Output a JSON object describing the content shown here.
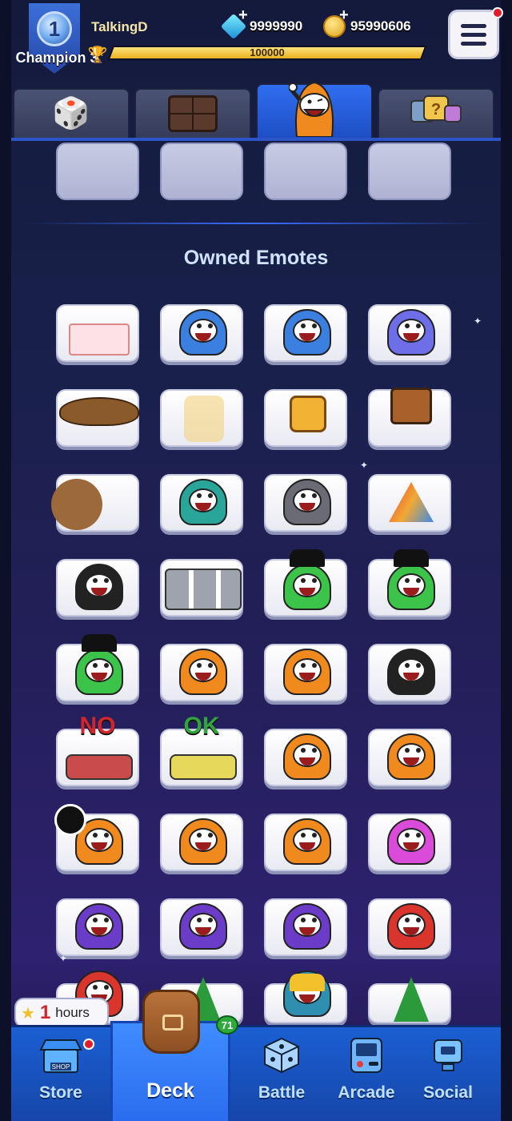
{
  "player": {
    "name": "TalkingD",
    "rank_number": "1",
    "rank_label": "Champion 3",
    "xp_text": "100000",
    "xp_fill_fraction": 1.0
  },
  "currencies": {
    "gems": "9999990",
    "coins": "95990606"
  },
  "tabs": [
    {
      "name": "dice",
      "icon": "dice-icon",
      "active": false
    },
    {
      "name": "board",
      "icon": "board-icon",
      "active": false
    },
    {
      "name": "emotes",
      "icon": "emote-character-icon",
      "active": true
    },
    {
      "name": "misc",
      "icon": "mystery-dice-icon",
      "active": false
    }
  ],
  "equipped_slots_count": 4,
  "section": {
    "title": "Owned Emotes"
  },
  "emotes": [
    {
      "id": "birthday-cake",
      "text": ""
    },
    {
      "id": "blue-hood-drool",
      "text": ""
    },
    {
      "id": "blue-hood-sad",
      "text": ""
    },
    {
      "id": "blue-hood-cry",
      "text": ""
    },
    {
      "id": "cowboy-hat",
      "text": ""
    },
    {
      "id": "box-ghost-flag",
      "text": ""
    },
    {
      "id": "gold-tv-head",
      "text": ""
    },
    {
      "id": "tv-head-guns",
      "text": ""
    },
    {
      "id": "rolling-boulder",
      "text": ""
    },
    {
      "id": "white-flag",
      "text": ""
    },
    {
      "id": "grey-hood-sad",
      "text": ""
    },
    {
      "id": "prism",
      "text": ""
    },
    {
      "id": "party-popper",
      "text": ""
    },
    {
      "id": "robot-row",
      "text": ""
    },
    {
      "id": "green-h-pray",
      "text": ""
    },
    {
      "id": "green-h-wink",
      "text": ""
    },
    {
      "id": "green-h-kiss",
      "text": ""
    },
    {
      "id": "orange-cheer",
      "text": ""
    },
    {
      "id": "orange-smile",
      "text": ""
    },
    {
      "id": "ninja-gem",
      "text": ""
    },
    {
      "id": "no-swords",
      "text": "NO"
    },
    {
      "id": "ok-lemon",
      "text": "OK"
    },
    {
      "id": "orange-shock",
      "text": ""
    },
    {
      "id": "orange-grin",
      "text": ""
    },
    {
      "id": "frying-pan",
      "text": ""
    },
    {
      "id": "orange-tongue",
      "text": ""
    },
    {
      "id": "orange-love",
      "text": ""
    },
    {
      "id": "pink-hair-love",
      "text": ""
    },
    {
      "id": "purple-glasses-angry",
      "text": ""
    },
    {
      "id": "purple-glasses-smug",
      "text": ""
    },
    {
      "id": "purple-matrix",
      "text": ""
    },
    {
      "id": "red-rage-table",
      "text": ""
    },
    {
      "id": "red-partial",
      "text": ""
    },
    {
      "id": "christmas-reindeer",
      "text": ""
    },
    {
      "id": "hardhat",
      "text": ""
    },
    {
      "id": "christmas-tree",
      "text": ""
    }
  ],
  "timer": {
    "value": "1",
    "unit": "hours"
  },
  "nav": {
    "store": "Store",
    "deck": "Deck",
    "battle": "Battle",
    "arcade": "Arcade",
    "social": "Social",
    "deck_count": "71"
  },
  "colors": {
    "accent_blue": "#2a6cee",
    "notif_red": "#e21d2b",
    "xp_gold": "#e9b21f",
    "emote_orange": "#f08a1e",
    "emote_green": "#3bc34a",
    "emote_purple": "#6a3cc7",
    "emote_blue": "#3b7fe0"
  }
}
